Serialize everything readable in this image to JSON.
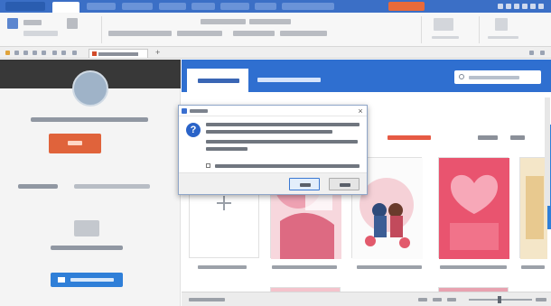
{
  "app": {
    "title": ""
  },
  "colors": {
    "titlebar": "#3b6fc6",
    "accent_orange": "#e0633b",
    "accent_blue": "#2f7fd8",
    "dialog_icon": "#2a63c8"
  },
  "ribbon": {
    "tabs": [
      "",
      "",
      "",
      "",
      "",
      "",
      "",
      "",
      ""
    ]
  },
  "quickbar": {
    "document_tab": ""
  },
  "left_panel": {
    "promo_text": "",
    "signup_label": "",
    "recent_label": "",
    "recent_link": "",
    "empty_text": "",
    "open_label": ""
  },
  "main": {
    "tabs": [
      {
        "label": ""
      },
      {
        "label": ""
      }
    ],
    "search_placeholder": "",
    "category_active": "",
    "filters": [
      "",
      ""
    ],
    "cards": [
      {
        "caption": "",
        "icon": "plus-icon"
      },
      {
        "caption": ""
      },
      {
        "caption": ""
      },
      {
        "caption": ""
      },
      {
        "caption": ""
      }
    ]
  },
  "dialog": {
    "title": "",
    "message_lines": [
      "",
      "",
      "",
      ""
    ],
    "checkbox_label": "",
    "yes_label": "",
    "no_label": "",
    "icon": "question-icon"
  },
  "status": {
    "left_text": "",
    "zoom": ""
  }
}
